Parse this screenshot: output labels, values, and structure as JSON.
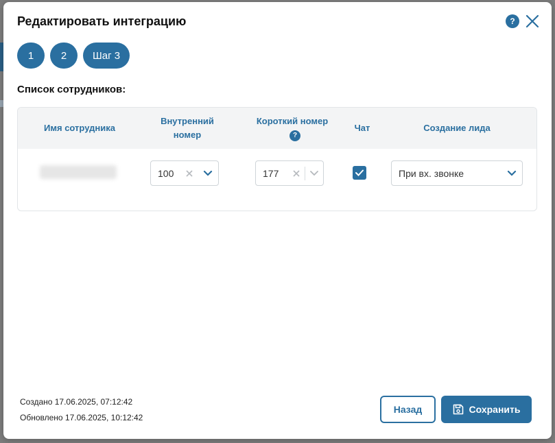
{
  "modal": {
    "title": "Редактировать интеграцию",
    "help_label": "?"
  },
  "steps": [
    "1",
    "2",
    "Шаг 3"
  ],
  "employees": {
    "section_title": "Список сотрудников:",
    "columns": {
      "name": "Имя сотрудника",
      "internal_number": "Внутренний номер",
      "short_number": "Короткий номер",
      "short_number_help": "?",
      "chat": "Чат",
      "lead_creation": "Создание лида"
    },
    "rows": [
      {
        "internal_number": "100",
        "short_number": "177",
        "chat_checked": true,
        "lead_creation": "При вх. звонке"
      }
    ]
  },
  "footer": {
    "created": "Создано 17.06.2025, 07:12:42",
    "updated": "Обновлено 17.06.2025, 10:12:42",
    "back_label": "Назад",
    "save_label": "Сохранить"
  },
  "icons": {
    "help": "help-icon",
    "close": "close-icon",
    "clear": "clear-icon",
    "chevron": "chevron-down-icon",
    "check": "checkmark-icon",
    "save": "floppy-disk-icon"
  },
  "colors": {
    "accent": "#2a6fa0",
    "backdrop": "#7d7d7d"
  }
}
